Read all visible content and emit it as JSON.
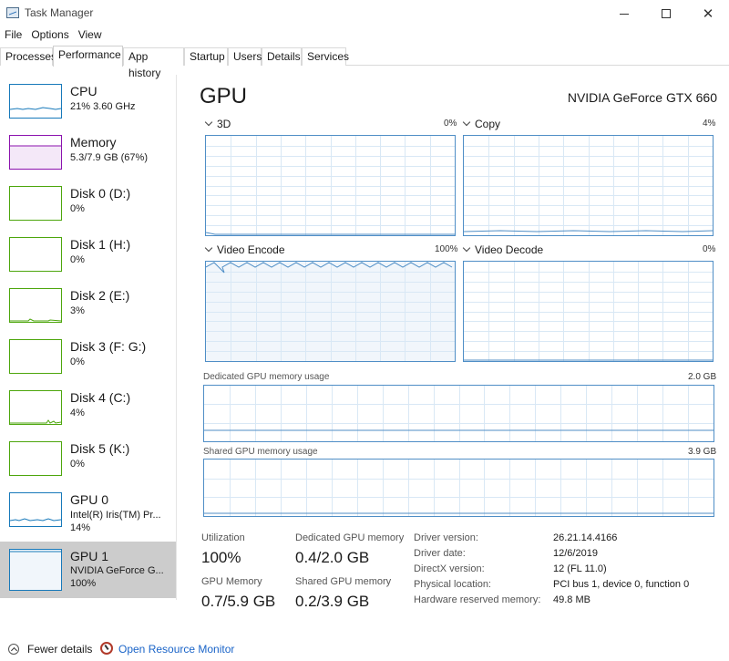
{
  "window": {
    "title": "Task Manager",
    "controls": {
      "minimize": "minimize",
      "maximize": "maximize",
      "close": "✕"
    }
  },
  "menu": [
    "File",
    "Options",
    "View"
  ],
  "tabs": [
    {
      "label": "Processes",
      "active": false
    },
    {
      "label": "Performance",
      "active": true
    },
    {
      "label": "App history",
      "active": false
    },
    {
      "label": "Startup",
      "active": false
    },
    {
      "label": "Users",
      "active": false
    },
    {
      "label": "Details",
      "active": false
    },
    {
      "label": "Services",
      "active": false
    }
  ],
  "sidebar": [
    {
      "name": "CPU",
      "detail": "21% 3.60 GHz",
      "color": "#1779ba",
      "selected": false
    },
    {
      "name": "Memory",
      "detail": "5.3/7.9 GB (67%)",
      "color": "#8b12ae",
      "selected": false
    },
    {
      "name": "Disk 0 (D:)",
      "detail": "0%",
      "color": "#4da60c",
      "selected": false
    },
    {
      "name": "Disk 1 (H:)",
      "detail": "0%",
      "color": "#4da60c",
      "selected": false
    },
    {
      "name": "Disk 2 (E:)",
      "detail": "3%",
      "color": "#4da60c",
      "selected": false
    },
    {
      "name": "Disk 3 (F: G:)",
      "detail": "0%",
      "color": "#4da60c",
      "selected": false
    },
    {
      "name": "Disk 4 (C:)",
      "detail": "4%",
      "color": "#4da60c",
      "selected": false
    },
    {
      "name": "Disk 5 (K:)",
      "detail": "0%",
      "color": "#4da60c",
      "selected": false
    },
    {
      "name": "GPU 0",
      "detail": "Intel(R) Iris(TM) Pr...",
      "detail2": "14%",
      "color": "#1779ba",
      "selected": false
    },
    {
      "name": "GPU 1",
      "detail": "NVIDIA GeForce G...",
      "detail2": "100%",
      "color": "#1779ba",
      "selected": true
    }
  ],
  "main": {
    "title": "GPU",
    "model": "NVIDIA GeForce GTX 660",
    "engines": [
      {
        "label": "3D",
        "percent": "0%"
      },
      {
        "label": "Copy",
        "percent": "4%"
      },
      {
        "label": "Video Encode",
        "percent": "100%"
      },
      {
        "label": "Video Decode",
        "percent": "0%"
      }
    ],
    "dedicated_memory": {
      "label": "Dedicated GPU memory usage",
      "max": "2.0 GB"
    },
    "shared_memory": {
      "label": "Shared GPU memory usage",
      "max": "3.9 GB"
    },
    "stats": {
      "utilization_label": "Utilization",
      "utilization_value": "100%",
      "dedicated_label": "Dedicated GPU memory",
      "dedicated_value": "0.4/2.0 GB",
      "gpu_memory_label": "GPU Memory",
      "gpu_memory_value": "0.7/5.9 GB",
      "shared_label": "Shared GPU memory",
      "shared_value": "0.2/3.9 GB"
    },
    "info": [
      {
        "key": "Driver version:",
        "value": "26.21.14.4166"
      },
      {
        "key": "Driver date:",
        "value": "12/6/2019"
      },
      {
        "key": "DirectX version:",
        "value": "12 (FL 11.0)"
      },
      {
        "key": "Physical location:",
        "value": "PCI bus 1, device 0, function 0"
      },
      {
        "key": "Hardware reserved memory:",
        "value": "49.8 MB"
      }
    ]
  },
  "footer": {
    "fewer_details": "Fewer details",
    "open_monitor": "Open Resource Monitor"
  },
  "colors": {
    "graph_border": "#4f8ec6",
    "graph_grid": "#d9e8f5",
    "graph_fill": "#f1f6fb",
    "selected_bg": "#cccccc",
    "link": "#1a64c8"
  }
}
